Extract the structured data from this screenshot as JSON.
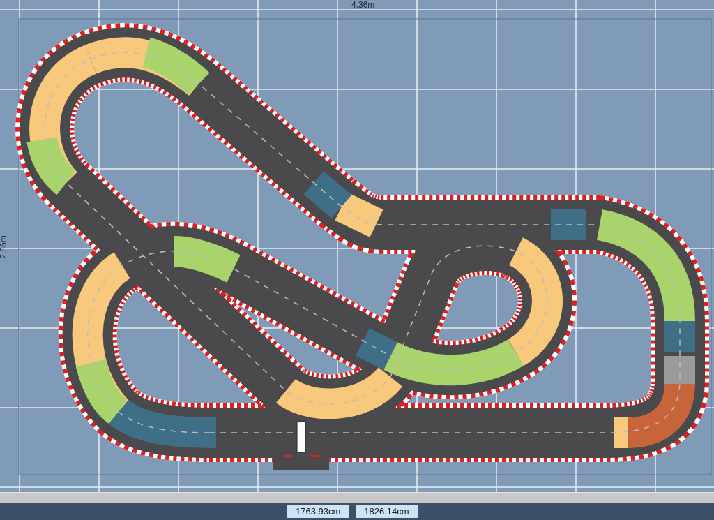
{
  "canvas": {
    "width_label": "4,36m",
    "height_label": "2,86m"
  },
  "status_bar": {
    "fields": [
      "1763.93cm",
      "1826.14cm"
    ]
  }
}
